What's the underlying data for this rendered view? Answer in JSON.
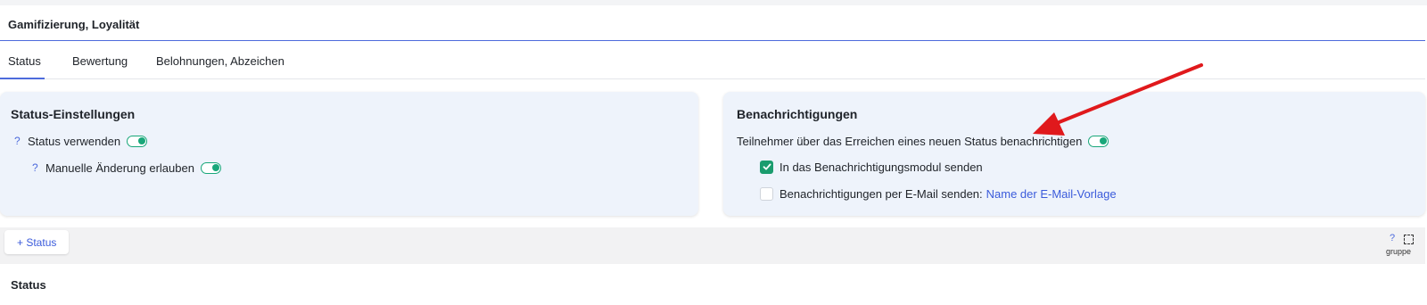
{
  "header": {
    "title": "Gamifizierung, Loyalität"
  },
  "tabs": [
    {
      "label": "Status",
      "active": true
    },
    {
      "label": "Bewertung",
      "active": false
    },
    {
      "label": "Belohnungen, Abzeichen",
      "active": false
    }
  ],
  "status_settings": {
    "title": "Status-Einstellungen",
    "use_status": {
      "help": "?",
      "label": "Status verwenden",
      "enabled": true
    },
    "manual_change": {
      "help": "?",
      "label": "Manuelle Änderung erlauben",
      "enabled": true
    }
  },
  "notifications": {
    "title": "Benachrichtigungen",
    "notify_new_status": {
      "label": "Teilnehmer über das Erreichen eines neuen Status benachrichtigen",
      "enabled": true
    },
    "send_to_module": {
      "label": "In das Benachrichtigungsmodul senden",
      "checked": true
    },
    "send_email": {
      "label": "Benachrichtigungen per E-Mail senden:",
      "link": "Name der E-Mail-Vorlage",
      "checked": false
    }
  },
  "toolbar": {
    "add_status_label": "+ Status",
    "help": "?",
    "group_label": "gruppe"
  },
  "status_section": {
    "title": "Status"
  },
  "colors": {
    "accent": "#4d6bdc",
    "toggle_on": "#19a77a",
    "panel_bg": "#eef3fb",
    "annotation_arrow": "#e0191c"
  }
}
